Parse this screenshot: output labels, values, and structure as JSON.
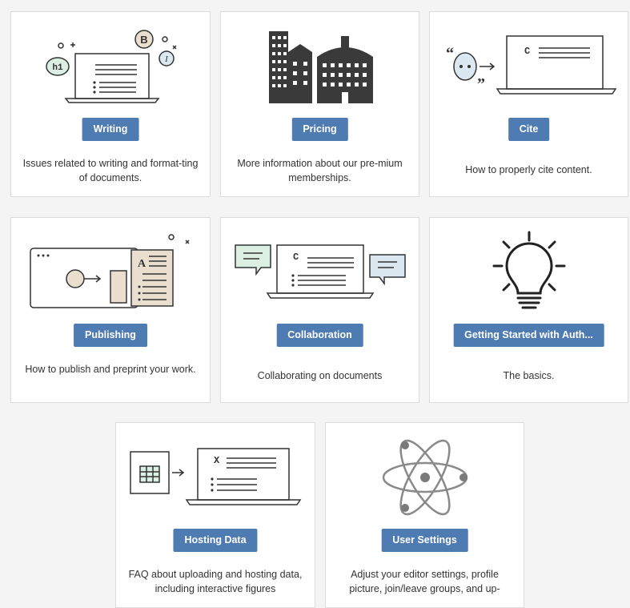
{
  "cards": [
    {
      "label": "Writing",
      "desc": "Issues related to writing and format-ting of documents."
    },
    {
      "label": "Pricing",
      "desc": "More information about our pre-mium memberships."
    },
    {
      "label": "Cite",
      "desc": "How to properly cite content."
    },
    {
      "label": "Publishing",
      "desc": "How to publish and preprint your work."
    },
    {
      "label": "Collaboration",
      "desc": "Collaborating on documents"
    },
    {
      "label": "Getting Started with Auth...",
      "desc": "The basics."
    },
    {
      "label": "Hosting Data",
      "desc": "FAQ about uploading and hosting data, including interactive figures"
    },
    {
      "label": "User Settings",
      "desc": "Adjust your editor settings, profile picture, join/leave groups, and up-"
    }
  ],
  "icons": {
    "writing_heading": "h1",
    "writing_bold": "B",
    "writing_italic": "I",
    "cite_letter": "C",
    "publishing_letter": "A",
    "collab_letter": "C",
    "hosting_letter": "X"
  },
  "colors": {
    "button": "#4f7bb3",
    "accent_green": "#dcefe3",
    "accent_blue": "#dbe8f2",
    "accent_tan": "#eadfcf",
    "line": "#333333"
  }
}
